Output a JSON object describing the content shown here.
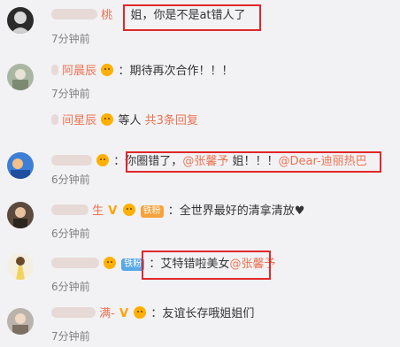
{
  "comments": [
    {
      "user": "桃",
      "text": "姐，你是不是at错人了",
      "time": "7分钟前"
    },
    {
      "user": "阿晨辰",
      "sep": "：",
      "text": "期待再次合作！！！",
      "time": "7分钟前"
    },
    {
      "user": "间星辰",
      "text": "等人",
      "replies": "共3条回复"
    },
    {
      "sep": "：",
      "text": "你圈错了，",
      "mention1": "@张馨予",
      "text2": " 姐！！！",
      "mention2": "@Dear-迪丽热巴",
      "time": "6分钟前"
    },
    {
      "user": "生",
      "badge": "铁粉",
      "sep": "：",
      "text": "全世界最好的清拿清放♥",
      "time": "6分钟前"
    },
    {
      "badge": "铁粉",
      "sep": "：",
      "text": "艾特错啦美女",
      "mention": "@张馨予",
      "time": "6分钟前"
    },
    {
      "user": "满-",
      "sep": "：",
      "text": "友谊长存哦姐姐们",
      "time": "7分钟前"
    }
  ],
  "colors": {
    "accent": "#eb7350",
    "highlight_box": "#e0272a",
    "background": "#f2f2f5",
    "time_text": "#808080"
  },
  "icons": [
    "vip-v-icon",
    "emoji-icon",
    "fan-badge-icon"
  ]
}
